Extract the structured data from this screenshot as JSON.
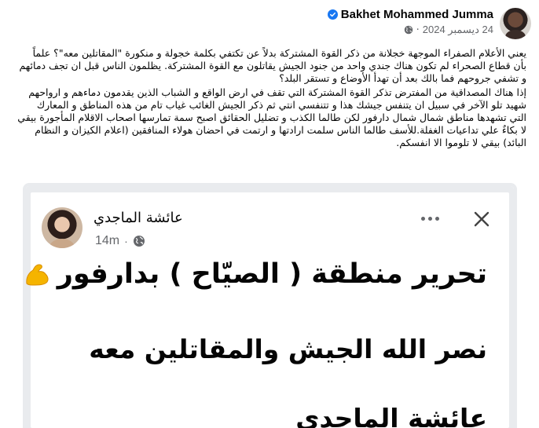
{
  "post": {
    "author": "Bakhet Mohammed Jumma",
    "date": "24 ديسمبر 2024",
    "date_separator": "·",
    "paragraphs": [
      "يعني الأعلام الصفراء الموجهة خجلانة من ذكر القوة المشتركة بدلاً عن تكتفي بكلمة خجولة و منكورة \"المقاتلين معه\"؟ علماً بأن قطاع الصحراء لم تكون هناك جندي واحد من جنود الجيش يقاتلون مع القوة المشتركة. يظلمون الناس قبل ان تجف دمائهم و تشفي جروحهم فما بالك  بعد أن تهدأ الأوضاع و تستقر البلد؟",
      "إذا هناك المصداقية من المفترض تذكر القوة المشتركة التي تقف في ارض الواقع و الشباب الذين يقدمون دماءهم و ارواحهم شهيد تلو الآخر في سبيل  ان يتنفس جيشك هذا و تتنفسي انتي ثم ذكر الجيش الغائب غياب تام من هذه المناطق و المعارك التي تشهدها مناطق شمال شمال دارفور لكن طالما الكذب و تضليل الحقائق اصبح سمة تمارسها اصحاب الاقلام المأجورة بيقي لا بكاءٌ علي تداعيات الغفلة.للأسف طالما الناس سلمت ارادتها و ارتمت في احضان هولاء المنافقين (اعلام الكيزان و النظام البائد) بيقي لا تلوموا الا انفسكم."
    ]
  },
  "shared_screenshot": {
    "author": "عائشة الماجدي",
    "time": "14m",
    "time_separator": "·",
    "line1": "تحرير منطقة ( الصيّاح ) بدارفور",
    "line2": "نصر الله الجيش والمقاتلين معه",
    "line3": "عائشة الماجدي"
  },
  "icons": {
    "verified": "verified-badge-icon",
    "audience": "globe-icon",
    "close": "close-icon",
    "more": "more-options-icon",
    "emoji": "flexed-biceps-emoji"
  },
  "colors": {
    "verified": "#1877f2",
    "meta_text": "#65676b",
    "emoji": "#f5b400"
  }
}
